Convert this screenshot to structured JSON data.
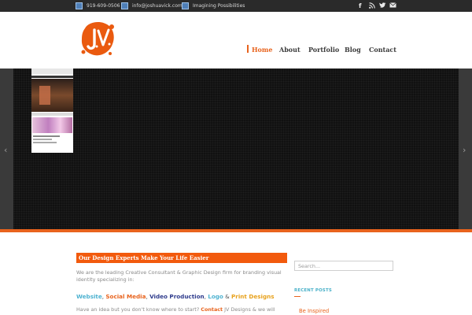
{
  "topbar": {
    "phone": "919-609-0506",
    "email": "info@joshuavick.com",
    "tagline": "Imagining Possibilities",
    "icons": [
      "phone-icon",
      "email-icon",
      "tagline-icon"
    ]
  },
  "social": {
    "facebook": "f",
    "rss": "◝",
    "twitter": "🐦",
    "mail": "✉"
  },
  "header": {
    "logo_text": "JV",
    "nav": [
      "Home",
      "About",
      "Portfolio",
      "Blog",
      "Contact"
    ],
    "active": "Home"
  },
  "slider": {
    "prev": "‹",
    "next": "›"
  },
  "main": {
    "heading": "Our Design Experts Make Your Life Easier",
    "intro_line1": "We are the leading Creative Consultant & Graphic Design firm for branding visual",
    "intro_line2": "identity specializing in:",
    "services": [
      {
        "label": "Website",
        "color": "#4fb3d1"
      },
      {
        "label": "Social Media",
        "color": "#e8631d"
      },
      {
        "label": "Video Production",
        "color": "#2e3b8c"
      },
      {
        "label": "Logo",
        "color": "#4fb3d1"
      },
      {
        "label": "Print Designs",
        "color": "#e8a21d"
      }
    ],
    "sep_comma": ", ",
    "sep_amp": " & ",
    "cta_prefix": "Have an idea but you don't know where to start?",
    "cta_link": "Contact",
    "cta_suffix": "JV Designs & we will"
  },
  "sidebar": {
    "search_placeholder": "Search...",
    "recent_title": "RECENT POSTS",
    "recent_posts": [
      "Be Inspired"
    ]
  },
  "colors": {
    "accent": "#e8631d",
    "topbar": "#2a2a2a",
    "heading_bar": "#f25a0d"
  }
}
